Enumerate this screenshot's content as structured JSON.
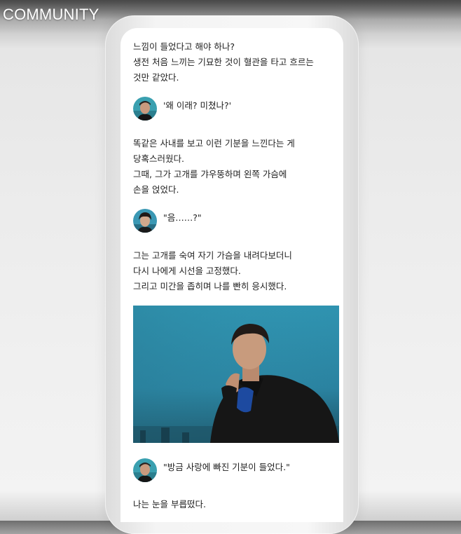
{
  "header": {
    "brand": "COMMUNITY"
  },
  "story": {
    "paragraph1": [
      "느낌이 들었다고 해야 하나?",
      "생전 처음 느끼는 기묘한 것이 혈관을 타고 흐르는",
      "것만 같았다."
    ],
    "dialogue1": "'왜 이래? 미쳤나?'",
    "paragraph2": [
      "똑같은 사내를 보고 이런 기분을 느낀다는 게",
      "당혹스러웠다.",
      "그때, 그가 고개를 갸우뚱하며 왼쪽 가슴에",
      "손을 얹었다."
    ],
    "dialogue2": "\"음……?\"",
    "paragraph3": [
      "그는 고개를 숙여 자기 가슴을 내려다보더니",
      "다시 나에게 시선을 고정했다.",
      "그리고 미간을 좁히며 나를 빤히 응시했다."
    ],
    "dialogue3": "\"방금 사랑에 빠진 기분이 들었다.\"",
    "paragraph4": [
      "나는 눈을 부릅떴다."
    ]
  },
  "colors": {
    "photo_sky": "#2d8fa8",
    "photo_dark": "#1b4f62",
    "coat": "#161616",
    "avatar_teal": "#3aa0b0"
  },
  "icons": {
    "avatar": "character-avatar"
  }
}
